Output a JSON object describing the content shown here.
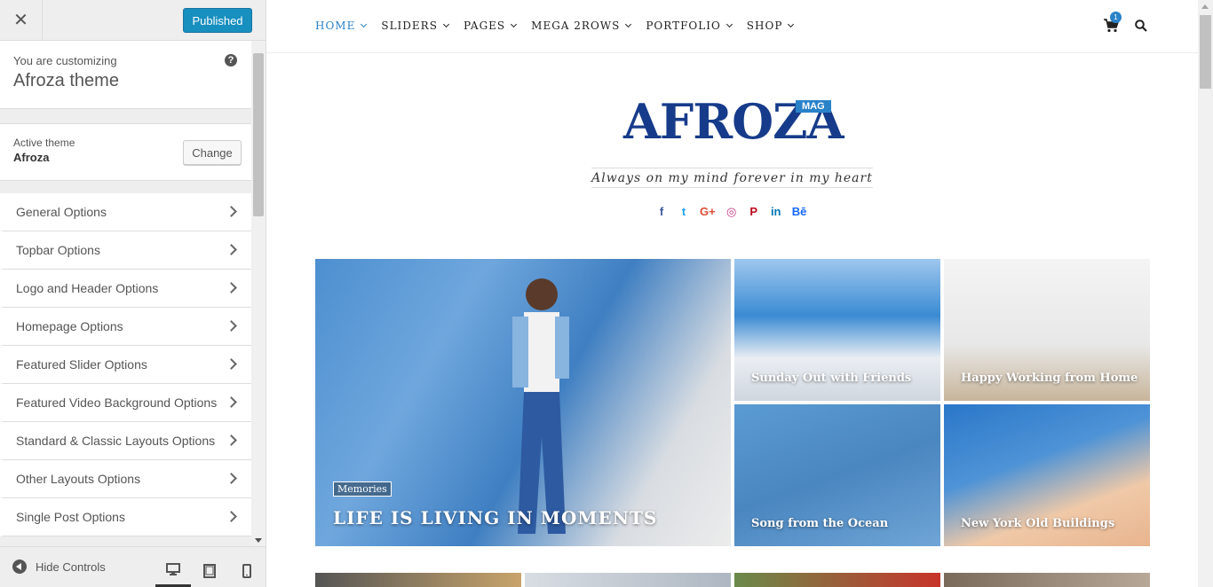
{
  "customizer": {
    "close_icon": "close-icon",
    "publish_label": "Published",
    "info": {
      "customizing_label": "You are customizing",
      "theme_name": "Afroza theme",
      "help_label": "?"
    },
    "active_theme": {
      "label": "Active theme",
      "name": "Afroza",
      "change_label": "Change"
    },
    "sections": [
      {
        "label": "General Options"
      },
      {
        "label": "Topbar Options"
      },
      {
        "label": "Logo and Header Options"
      },
      {
        "label": "Homepage Options"
      },
      {
        "label": "Featured Slider Options"
      },
      {
        "label": "Featured Video Background Options"
      },
      {
        "label": "Standard & Classic Layouts Options"
      },
      {
        "label": "Other Layouts Options"
      },
      {
        "label": "Single Post Options"
      }
    ],
    "footer": {
      "hide_controls_label": "Hide Controls",
      "active_device": "desktop"
    }
  },
  "preview": {
    "nav": {
      "items": [
        {
          "label": "HOME",
          "active": true
        },
        {
          "label": "SLIDERS",
          "active": false
        },
        {
          "label": "PAGES",
          "active": false
        },
        {
          "label": "MEGA 2ROWS",
          "active": false
        },
        {
          "label": "PORTFOLIO",
          "active": false
        },
        {
          "label": "SHOP",
          "active": false
        }
      ],
      "cart_count": "1"
    },
    "logo": {
      "text": "AFROZA",
      "badge": "MAG"
    },
    "tagline": "Always on my mind forever in my heart",
    "socials": [
      {
        "icon": "facebook-icon",
        "glyph": "f",
        "color": "#3b5998"
      },
      {
        "icon": "twitter-icon",
        "glyph": "t",
        "color": "#1da1f2"
      },
      {
        "icon": "google-plus-icon",
        "glyph": "G+",
        "color": "#dd4b39"
      },
      {
        "icon": "instagram-icon",
        "glyph": "◎",
        "color": "#c13584"
      },
      {
        "icon": "pinterest-icon",
        "glyph": "P",
        "color": "#bd081c"
      },
      {
        "icon": "linkedin-icon",
        "glyph": "in",
        "color": "#0077b5"
      },
      {
        "icon": "behance-icon",
        "glyph": "Bē",
        "color": "#1769ff"
      }
    ],
    "featured": {
      "main": {
        "category": "Memories",
        "title": "LIFE IS LIVING IN MOMENTS"
      },
      "tiles": [
        {
          "title": "Sunday Out with Friends"
        },
        {
          "title": "Happy Working from Home"
        },
        {
          "title": "Song from the Ocean"
        },
        {
          "title": "New York Old Buildings"
        }
      ]
    }
  },
  "colors": {
    "accent": "#2a82c9",
    "logo": "#163b8a",
    "wp_primary": "#0085ba"
  }
}
